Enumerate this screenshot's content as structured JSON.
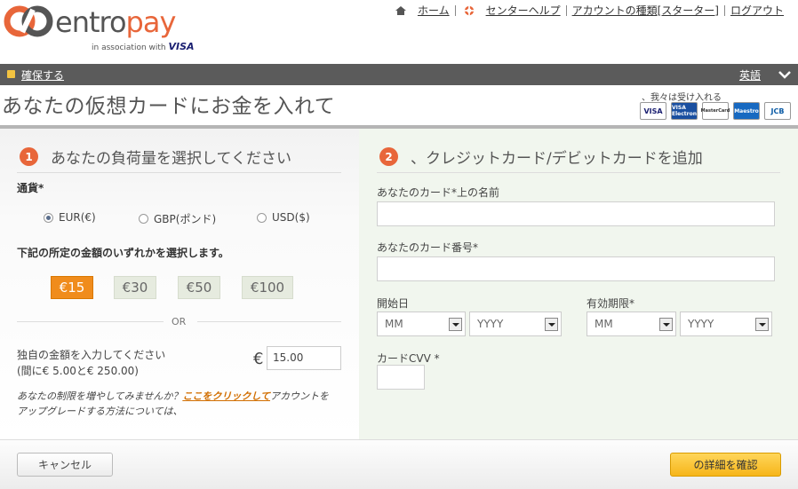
{
  "header": {
    "logo_text_a": "entro",
    "logo_text_b": "pay",
    "logo_sub": "in association with",
    "logo_visa": "VISA",
    "links": {
      "home": "ホーム",
      "help": "センターヘルプ",
      "account_type": "アカウントの種類[スターター]",
      "logout": "ログアウト"
    }
  },
  "bar": {
    "secure": "確保する",
    "language": "英語"
  },
  "page": {
    "title": "あなたの仮想カードにお金を入れて",
    "accepted_label": "、我々は受け入れる"
  },
  "cards": [
    "VISA",
    "VISA Electron",
    "MasterCard",
    "Maestro",
    "JCB"
  ],
  "step1": {
    "num": "1",
    "title": "あなたの負荷量を選択してください",
    "currency_label": "通貨*",
    "currencies": [
      {
        "label": "EUR(€)",
        "selected": true
      },
      {
        "label": "GBP(ポンド)",
        "selected": false
      },
      {
        "label": "USD($)",
        "selected": false
      }
    ],
    "amount_label": "下記の所定の金額のいずれかを選択します。",
    "amounts": [
      {
        "label": "€15",
        "selected": true
      },
      {
        "label": "€30",
        "selected": false
      },
      {
        "label": "€50",
        "selected": false
      },
      {
        "label": "€100",
        "selected": false
      }
    ],
    "or": "OR",
    "custom_label": "独自の金額を入力してください",
    "custom_range": "(間に€ 5.00と€ 250.00)",
    "currency_symbol": "€",
    "custom_value": "15.00",
    "note_a": "あなたの制限を増やしてみませんか？",
    "note_link": "ここをクリックして",
    "note_b": "アカウントを",
    "note_c": "アップグレードする方法については、"
  },
  "step2": {
    "num": "2",
    "title": "、クレジットカード/デビットカードを追加",
    "name_label": "あなたのカード*上の名前",
    "number_label": "あなたのカード番号*",
    "start_label": "開始日",
    "expiry_label": "有効期限*",
    "mm": "MM",
    "yyyy": "YYYY",
    "cvv_label": "カードCVV *"
  },
  "footer": {
    "cancel": "キャンセル",
    "confirm": "の詳細を確認"
  }
}
